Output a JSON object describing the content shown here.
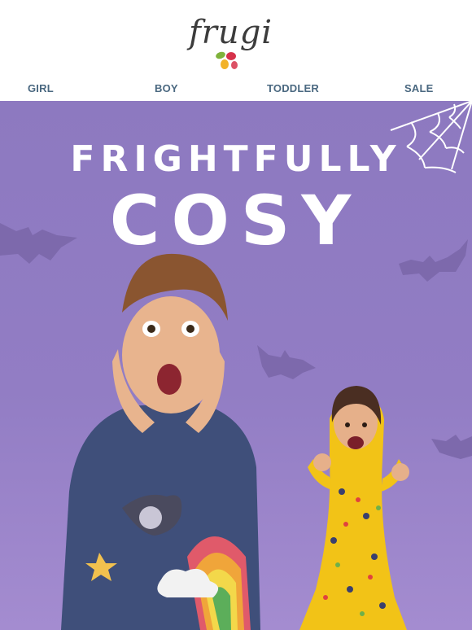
{
  "brand": {
    "logo_text": "frugi"
  },
  "nav": {
    "items": [
      {
        "label": "GIRL"
      },
      {
        "label": "BOY"
      },
      {
        "label": "TODDLER"
      },
      {
        "label": "SALE"
      }
    ]
  },
  "hero": {
    "headline_line1": "FRIGHTFULLY",
    "headline_line2": "COSY",
    "background_color": "#8d79c0"
  },
  "colors": {
    "nav_text": "#4a6880",
    "logo_text": "#3c3c3c",
    "leaf_green": "#7fb23b",
    "leaf_red": "#d6324a",
    "leaf_yellow": "#f2b32a"
  }
}
